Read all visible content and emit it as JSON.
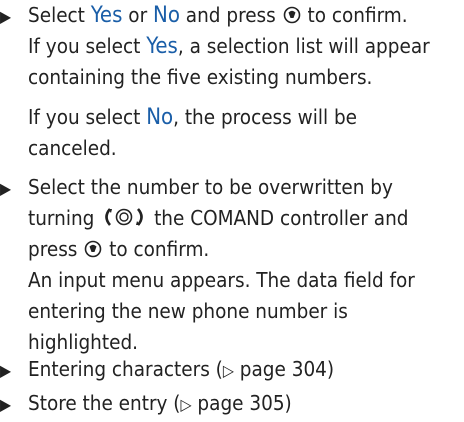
{
  "step1": {
    "bullet": "▶",
    "p1": {
      "pre": "Select ",
      "yes": "Yes",
      "or": " or ",
      "no": "No",
      "post": " and press",
      "post2": " to confirm."
    },
    "p2": {
      "pre": "If you select ",
      "yes": "Yes",
      "post": ", a selection list will appear",
      "line2": "containing the five existing numbers."
    },
    "p3": {
      "pre": "If you select ",
      "no": "No",
      "post": ", the process will be",
      "line2": "canceled."
    }
  },
  "step2": {
    "bullet": "▶",
    "line1": "Select the number to be overwritten by",
    "line2_pre": "turning",
    "line2_post": "the COMAND controller and",
    "line3_pre": "press",
    "line3_post": "to confirm.",
    "line4": "An input menu appears. The data field for",
    "line5": "entering the new phone number is",
    "line6": "highlighted."
  },
  "step3": {
    "bullet": "▶",
    "text": "Entering characters (",
    "ref": "▷",
    "page": " page 304)"
  },
  "step4": {
    "bullet": "▶",
    "text": "Store the entry (",
    "ref": "▷",
    "page": " page 305)"
  },
  "icons": {
    "press": "controller-press-icon",
    "turn": "controller-turn-icon"
  },
  "colors": {
    "highlight": "#1a5ea8",
    "text": "#222222"
  }
}
